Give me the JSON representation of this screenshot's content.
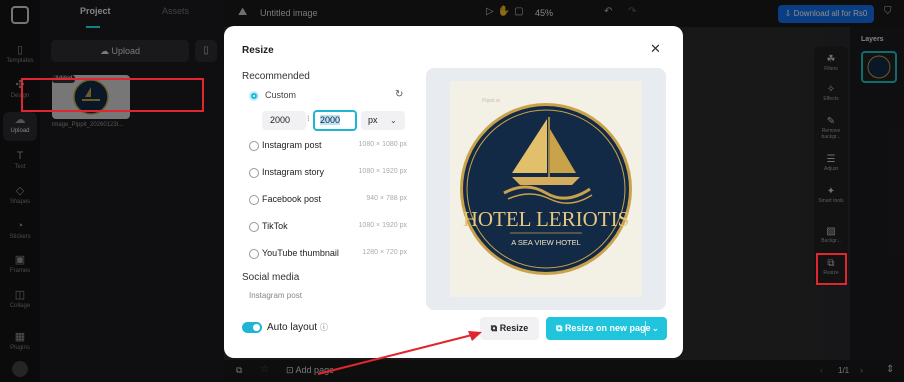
{
  "colors": {
    "accent": "#20c4dd",
    "highlight": "#e0262e",
    "brand_blue": "#1570ef",
    "navy": "#122a46",
    "gold": "#c9a24a"
  },
  "rail": {
    "items": [
      {
        "label": "Templates",
        "icon": "templates-icon"
      },
      {
        "label": "Design",
        "icon": "design-icon"
      },
      {
        "label": "Upload",
        "icon": "upload-cloud-icon"
      },
      {
        "label": "Text",
        "icon": "text-icon"
      },
      {
        "label": "Shapes",
        "icon": "shapes-icon"
      },
      {
        "label": "Stickers",
        "icon": "stickers-icon"
      },
      {
        "label": "Frames",
        "icon": "frames-icon"
      },
      {
        "label": "Collage",
        "icon": "collage-icon"
      },
      {
        "label": "Plugins",
        "icon": "plugins-icon"
      }
    ]
  },
  "panel": {
    "tabs": [
      "Project",
      "Assets"
    ],
    "upload_label": "Upload",
    "added_badge": "Added",
    "file_name": "image_Pippit_20260123l..."
  },
  "topbar": {
    "title": "Untitled image",
    "zoom": "45%",
    "download_label": "Download all for Rs0"
  },
  "tools": [
    "Filters",
    "Effects",
    "Remove backgr...",
    "Adjust",
    "Smart tools",
    "Backgr...",
    "Resize"
  ],
  "layers": {
    "title": "Layers"
  },
  "bottombar": {
    "add_page": "Add page",
    "page_count": "1/1"
  },
  "modal": {
    "title": "Resize",
    "recommended_label": "Recommended",
    "custom_label": "Custom",
    "width": "2000",
    "height": "2000",
    "unit": "px",
    "options": [
      {
        "name": "Instagram post",
        "size": "1080 × 1080 px"
      },
      {
        "name": "Instagram story",
        "size": "1080 × 1920 px"
      },
      {
        "name": "Facebook post",
        "size": "940 × 788 px"
      },
      {
        "name": "TikTok",
        "size": "1080 × 1920 px"
      },
      {
        "name": "YouTube thumbnail",
        "size": "1280 × 720 px"
      }
    ],
    "social_label": "Social media",
    "social_option": "Instagram post",
    "auto_layout_label": "Auto layout",
    "preview_tag": "Pippit.ai",
    "logo_title": "HOTEL LERIOTIS",
    "logo_subtitle": "A SEA VIEW HOTEL",
    "resize_button": "Resize",
    "resize_new_page_button": "Resize on new page"
  }
}
